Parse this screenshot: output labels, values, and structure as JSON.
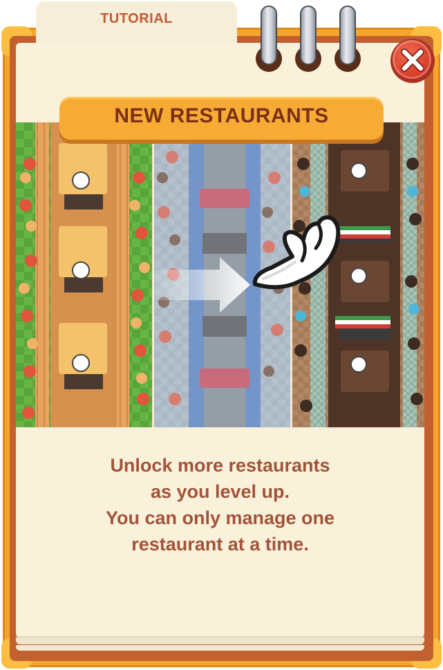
{
  "tutorial_tab": {
    "label": "TUTORIAL"
  },
  "dialog": {
    "title": "NEW RESTAURANTS",
    "description_lines": [
      "Unlock more restaurants",
      "as you level up.",
      "You can only manage one",
      "restaurant at a time."
    ]
  },
  "close_button": {
    "icon": "close-icon",
    "color": "#d83a28"
  },
  "illustration": {
    "panels": [
      "green-restaurant",
      "blue-restaurant",
      "brown-restaurant"
    ],
    "arrow_icon": "right-arrow-icon",
    "hand_icon": "pointing-hand-icon"
  },
  "colors": {
    "frame": "#f6a52c",
    "banner": "#f8ab34",
    "title_text": "#7a3118",
    "body_text": "#a2533a",
    "paper": "#f9f1da"
  }
}
